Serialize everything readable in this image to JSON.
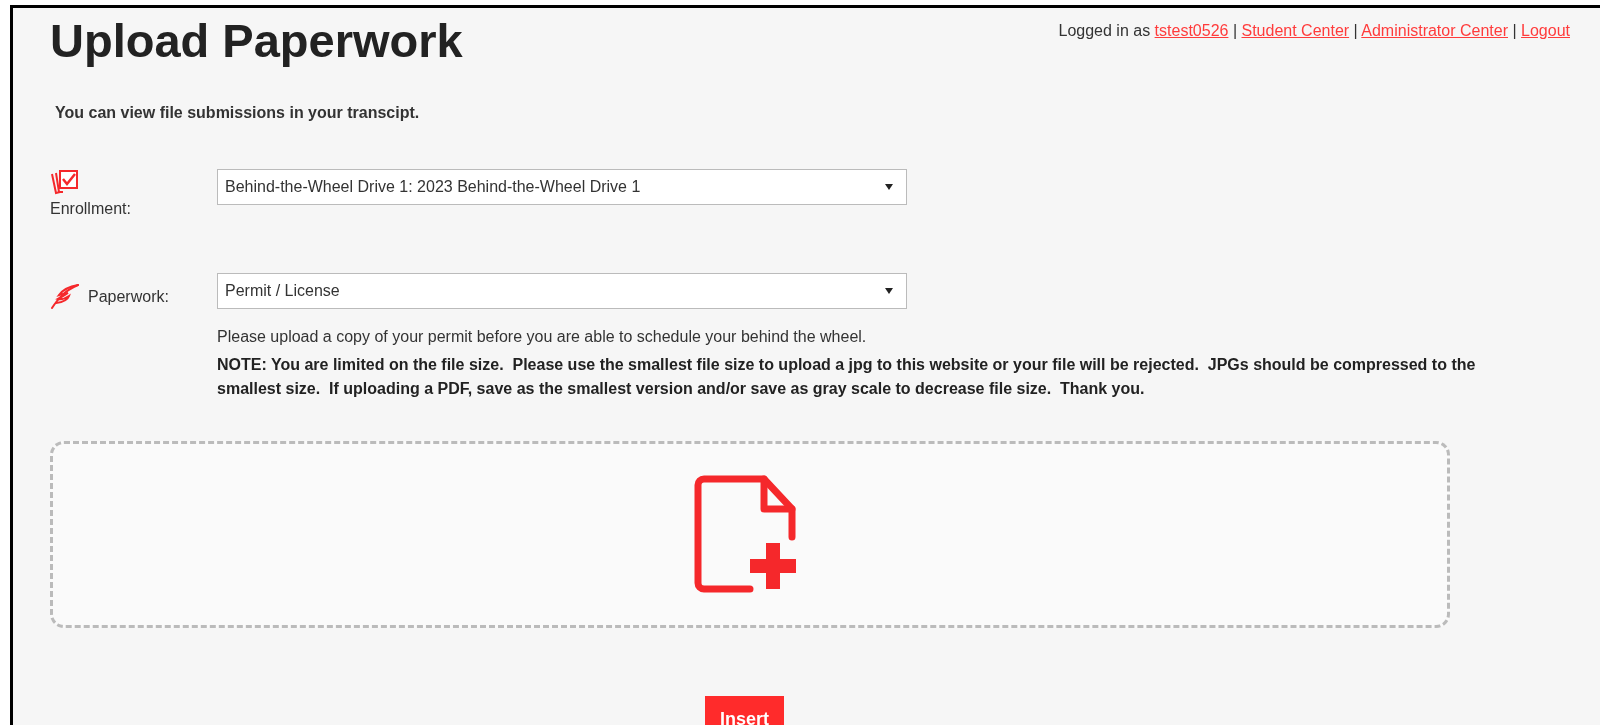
{
  "page": {
    "title": "Upload Paperwork"
  },
  "user_bar": [
    {
      "kind": "text",
      "text": "Logged in as"
    },
    {
      "kind": "link",
      "text": "tstest0526"
    },
    {
      "kind": "text",
      "text": "|"
    },
    {
      "kind": "link",
      "text": "Student Center"
    },
    {
      "kind": "text",
      "text": "|"
    },
    {
      "kind": "link",
      "text": "Administrator Center"
    },
    {
      "kind": "text",
      "text": "|"
    },
    {
      "kind": "link",
      "text": "Logout"
    }
  ],
  "intro": "You can view file submissions in your transcipt.",
  "fields": [
    {
      "kind": "enrollment",
      "label": "Enrollment:",
      "value": "Behind-the-Wheel Drive 1: 2023 Behind-the-Wheel Drive 1"
    },
    {
      "kind": "paperwork",
      "label": "Paperwork:",
      "value": "Permit / License"
    }
  ],
  "help_text": "Please upload a copy of your permit before you are able to schedule your behind the wheel.",
  "note": "NOTE: You are limited on the file size.  Please use the smallest file size to upload a jpg to this website or your file will be rejected.  JPGs should be compressed to the smallest size.  If uploading a PDF, save as the smallest version and/or save as gray scale to decrease file size.  Thank you.",
  "insert_button": "Insert"
}
